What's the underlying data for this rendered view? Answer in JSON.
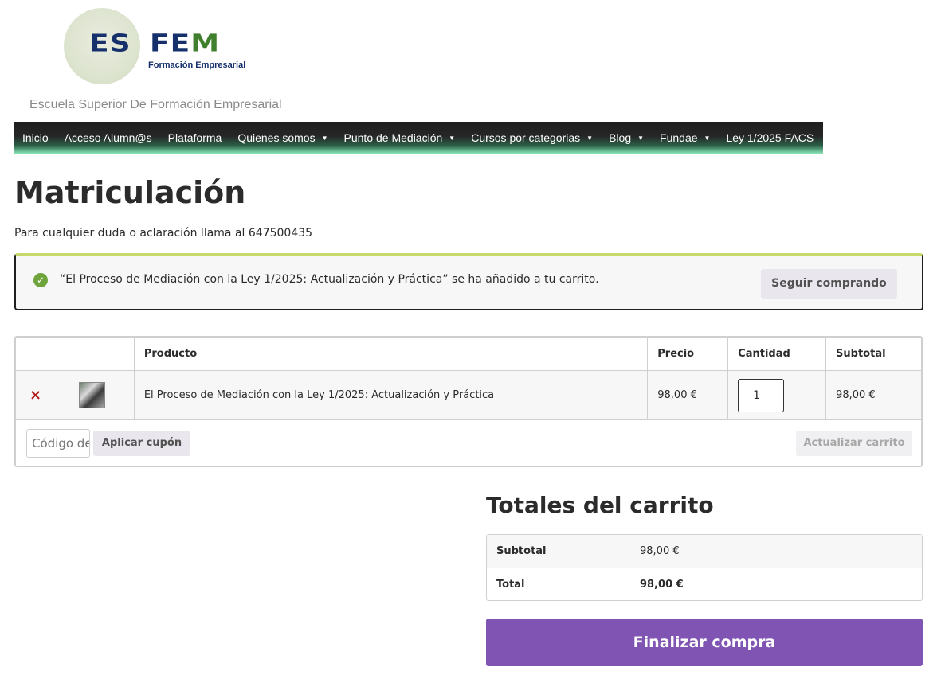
{
  "logo": {
    "es": "ES",
    "fe": "FE",
    "m": "M",
    "subtitle": "Formación Empresarial"
  },
  "site_description": "Escuela Superior De Formación Empresarial",
  "nav": [
    {
      "label": "Inicio",
      "has_submenu": false
    },
    {
      "label": "Acceso Alumn@s",
      "has_submenu": false
    },
    {
      "label": "Plataforma",
      "has_submenu": false
    },
    {
      "label": "Quienes somos",
      "has_submenu": true
    },
    {
      "label": "Punto de Mediación",
      "has_submenu": true
    },
    {
      "label": "Cursos por categorias",
      "has_submenu": true
    },
    {
      "label": "Blog",
      "has_submenu": true
    },
    {
      "label": "Fundae",
      "has_submenu": true
    },
    {
      "label": "Ley 1/2025 FACS",
      "has_submenu": false
    }
  ],
  "page": {
    "title": "Matriculación",
    "intro": "Para cualquier duda o aclaración llama al 647500435"
  },
  "notice": {
    "message": "“El Proceso de Mediación con la Ley 1/2025: Actualización y Práctica” se ha añadido a tu carrito.",
    "button": "Seguir comprando",
    "icon": "check-circle-icon"
  },
  "cart": {
    "headers": {
      "product": "Producto",
      "price": "Precio",
      "quantity": "Cantidad",
      "subtotal": "Subtotal"
    },
    "items": [
      {
        "remove": "×",
        "name": "El Proceso de Mediación con la Ley 1/2025: Actualización y Práctica",
        "price": "98,00 €",
        "quantity": "1",
        "subtotal": "98,00 €"
      }
    ],
    "coupon_placeholder": "Código de cupón",
    "apply_coupon": "Aplicar cupón",
    "update_cart": "Actualizar carrito"
  },
  "totals": {
    "title": "Totales del carrito",
    "subtotal_label": "Subtotal",
    "subtotal_value": "98,00 €",
    "total_label": "Total",
    "total_value": "98,00 €",
    "checkout": "Finalizar compra"
  },
  "colors": {
    "checkout_purple": "#7f54b3",
    "remove_red": "#b11b1b",
    "success_green": "#6fa33b"
  }
}
